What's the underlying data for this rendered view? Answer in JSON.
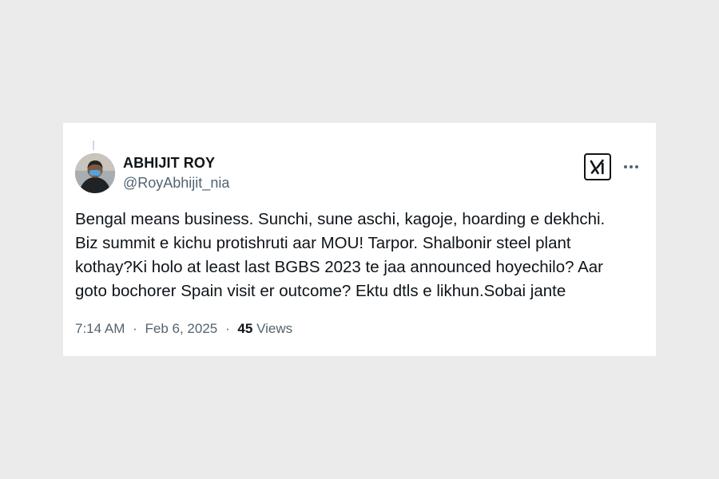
{
  "author": {
    "name": "ABHIJIT ROY",
    "handle": "@RoyAbhijit_nia"
  },
  "tweet": {
    "text": "Bengal means business. Sunchi, sune aschi, kagoje, hoarding e dekhchi.\nBiz summit e kichu protishruti aar MOU! Tarpor. Shalbonir steel plant\nkothay?Ki holo at least last BGBS 2023 te jaa announced hoyechilo? Aar\ngoto bochorer Spain visit er outcome? Ektu dtls e likhun.Sobai jante"
  },
  "meta": {
    "time": "7:14 AM",
    "separator": "·",
    "date": "Feb 6, 2025",
    "views_count": "45",
    "views_label": "Views"
  },
  "icons": {
    "grok": "grok-icon",
    "more": "more-horizontal-icon"
  },
  "colors": {
    "background": "#ebebeb",
    "card": "#ffffff",
    "text_primary": "#0f1419",
    "text_secondary": "#536471"
  }
}
